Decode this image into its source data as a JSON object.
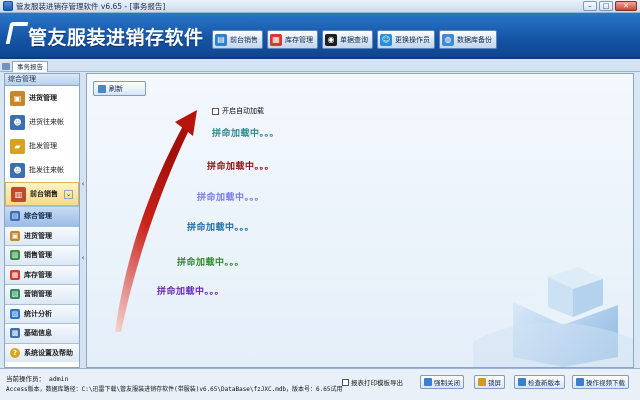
{
  "window": {
    "title": "管友服装进销存管理软件 v6.65 - [事务报告]",
    "buttons": {
      "minimize": "–",
      "maximize": "□",
      "close": "✕"
    }
  },
  "banner": {
    "app_name": "管友服装进销存软件",
    "toolbar": [
      {
        "label": "前台销售",
        "icon": "cash-register-icon",
        "color": "#2f7fd0",
        "glyph": "▤"
      },
      {
        "label": "库存管理",
        "icon": "inventory-icon",
        "color": "#d23b2e",
        "glyph": "▦"
      },
      {
        "label": "单据查询",
        "icon": "binoculars-icon",
        "color": "#1e1e1e",
        "glyph": "◉"
      },
      {
        "label": "更换操作员",
        "icon": "user-switch-icon",
        "color": "#2a8fd8",
        "glyph": "☺"
      },
      {
        "label": "数据库备份",
        "icon": "database-backup-icon",
        "color": "#3f8ad6",
        "glyph": "◍"
      }
    ]
  },
  "tabs": [
    {
      "label": "事务报告"
    }
  ],
  "sidebar": {
    "header": "综合管理",
    "items": [
      {
        "label": "进货管理",
        "bold": true,
        "icon": "purchase-icon",
        "color": "#c8862a",
        "glyph": "▣"
      },
      {
        "label": "进货往来帐",
        "bold": false,
        "icon": "supplier-account-icon",
        "color": "#3b6fb0",
        "glyph": "☻"
      },
      {
        "label": "批发管理",
        "bold": false,
        "icon": "wholesale-cart-icon",
        "color": "#d6a321",
        "glyph": "▰"
      },
      {
        "label": "批发往来帐",
        "bold": false,
        "icon": "customer-account-icon",
        "color": "#3b6fb0",
        "glyph": "☻"
      },
      {
        "label": "前台销售",
        "bold": true,
        "icon": "front-sales-icon",
        "color": "#c04b2a",
        "glyph": "▥",
        "selected": true,
        "dropdown": "⌄"
      }
    ],
    "categories": [
      {
        "label": "综合管理",
        "icon": "overview-icon",
        "color": "#3a6fb8",
        "glyph": "▤",
        "active": true
      },
      {
        "label": "进货管理",
        "icon": "purchase-icon",
        "color": "#c8862a",
        "glyph": "▣"
      },
      {
        "label": "销售管理",
        "icon": "sales-icon",
        "color": "#3a8f48",
        "glyph": "▥"
      },
      {
        "label": "库存管理",
        "icon": "inventory-icon",
        "color": "#d23b2e",
        "glyph": "▦"
      },
      {
        "label": "营销管理",
        "icon": "marketing-icon",
        "color": "#2d8c5d",
        "glyph": "▧"
      },
      {
        "label": "统计分析",
        "icon": "statistics-icon",
        "color": "#2a76c8",
        "glyph": "▨"
      },
      {
        "label": "基础信息",
        "icon": "basic-info-icon",
        "color": "#3b6fb0",
        "glyph": "▩"
      },
      {
        "label": "系统设置及帮助",
        "icon": "settings-help-icon",
        "color": "#d9a51c",
        "glyph": "?"
      }
    ]
  },
  "main": {
    "refresh_label": "刷新",
    "auto_load_label": "开启自动加载",
    "loading": [
      {
        "text": "拼命加载中。。。",
        "color": "#2b8a8a"
      },
      {
        "text": "拼命加载中。。。",
        "color": "#8c1414"
      },
      {
        "text": "拼命加载中。。。",
        "color": "#7c7cf0"
      },
      {
        "text": "拼命加载中。。。",
        "color": "#1f6fa8"
      },
      {
        "text": "拼命加载中。。。",
        "color": "#2e8c2e"
      },
      {
        "text": "拼命加载中。。。",
        "color": "#6a2bb8"
      }
    ]
  },
  "statusbar": {
    "operator_label": "当前操作员：",
    "operator_value": "admin",
    "db_path": "Access版本，数据库路径：C:\\迅雷下载\\管友服装进销存软件(带服装)v6.65\\DataBase\\fzJXC.mdb，版本号：6.65试用",
    "export_label": "报表打印模板导出",
    "buttons": [
      {
        "label": "强制关闭",
        "icon": "force-close-icon",
        "color": "#3a7fd0"
      },
      {
        "label": "锁屏",
        "icon": "lock-screen-icon",
        "color": "#d39a22"
      },
      {
        "label": "检查新版本",
        "icon": "update-check-icon",
        "color": "#3a7fd0"
      },
      {
        "label": "操作视频下载",
        "icon": "video-download-icon",
        "color": "#3a7fd0"
      }
    ]
  }
}
